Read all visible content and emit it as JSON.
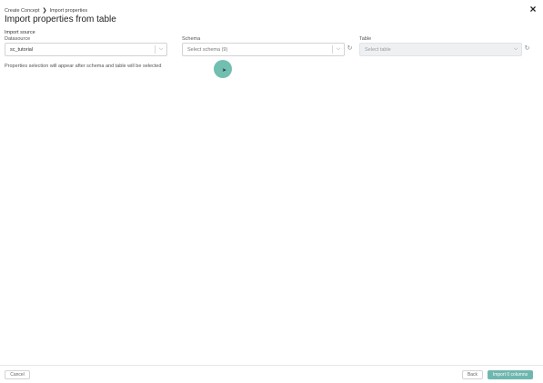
{
  "breadcrumb": {
    "items": [
      "Create Concept",
      "Import properties"
    ],
    "separator": "❯"
  },
  "page_title": "Import properties from table",
  "close_icon": "×",
  "import_source": {
    "title": "Import source",
    "datasource": {
      "label": "Datasource",
      "value": "sc_tutorial"
    },
    "schema": {
      "label": "Schema",
      "placeholder": "Select schema (9)"
    },
    "table": {
      "label": "Table",
      "placeholder": "Select table"
    }
  },
  "hint": "Properties selection will appear after schema and table will be selected",
  "footer": {
    "cancel_label": "Cancel",
    "back_label": "Back",
    "import_label": "Import 0 columns"
  },
  "icons": {
    "chevron": "⌵",
    "refresh": "↻"
  },
  "colors": {
    "accent": "#6fb7ae",
    "cursor_highlight": "#40aa96"
  }
}
